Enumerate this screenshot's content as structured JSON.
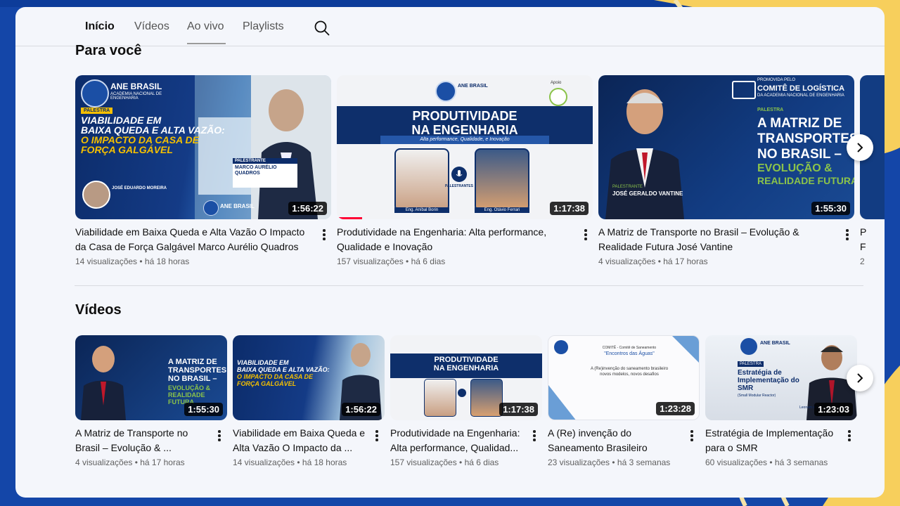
{
  "tabs": [
    {
      "label": "Início"
    },
    {
      "label": "Vídeos"
    },
    {
      "label": "Ao vivo"
    },
    {
      "label": "Playlists"
    }
  ],
  "sections": {
    "for_you": {
      "title": "Para você",
      "cards": [
        {
          "title_l1": "Viabilidade em Baixa Queda e Alta Vazão O Impacto",
          "title_l2": "da Casa de Força Galgável   Marco Aurélio Quadros",
          "meta": "14 visualizações • há 18 horas",
          "duration": "1:56:22",
          "thumb": {
            "brand": "ANE BRASIL",
            "brand_sub": "ACADEMIA NACIONAL DE ENGENHARIA",
            "tag": "PALESTRA",
            "headline1": "VIABILIDADE EM",
            "headline2": "BAIXA QUEDA E ALTA VAZÃO:",
            "headline3": "O IMPACTO DA CASA DE",
            "headline4": "FORÇA GALGÁVEL",
            "speaker_role": "PALESTRANTE",
            "speaker": "MARCO AURÉLIO QUADROS",
            "mod": "JOSÉ EDUARDO MOREIRA"
          }
        },
        {
          "title_l1": "Produtividade na Engenharia: Alta performance,",
          "title_l2": "Qualidade e Inovação",
          "meta": "157 visualizações • há 6 dias",
          "duration": "1:17:38",
          "thumb": {
            "headline1": "PRODUTIVIDADE",
            "headline2": "NA ENGENHARIA",
            "sub": "Alta performance, Qualidade, e Inovação",
            "left_name": "Eng. Aníbal Borin",
            "right_name": "Eng. Otávio Ferrari",
            "center": "PALESTRANTES",
            "apoio": "Apoio"
          }
        },
        {
          "title_l1": "A Matriz de Transporte no Brasil  – Evolução &",
          "title_l2": "Realidade Futura   José Vantine",
          "meta": "4 visualizações • há 17 horas",
          "duration": "1:55:30",
          "thumb": {
            "promo": "PROMOVIDA PELO",
            "committee": "COMITÊ DE LOGÍSTICA",
            "academy": "DA ACADEMIA NACIONAL DE ENGENHARIA",
            "tag": "PALESTRA",
            "headline1": "A MATRIZ DE",
            "headline2": "TRANSPORTES",
            "headline3": "NO BRASIL –",
            "headline4": "EVOLUÇÃO &",
            "headline5": "REALIDADE FUTURA",
            "speaker_role": "PALESTRANTE",
            "speaker": "JOSÉ GERALDO VANTINE"
          }
        },
        {
          "title_l1": "P",
          "title_l2": "F",
          "meta": "2"
        }
      ]
    },
    "videos": {
      "title": "Vídeos",
      "cards": [
        {
          "title_l1": "A Matriz de Transporte no",
          "title_l2": "Brasil  – Evolução & ...",
          "meta": "4 visualizações • há 17 horas",
          "duration": "1:55:30"
        },
        {
          "title_l1": "Viabilidade em Baixa Queda e",
          "title_l2": "Alta Vazão O Impacto da ...",
          "meta": "14 visualizações • há 18 horas",
          "duration": "1:56:22"
        },
        {
          "title_l1": "Produtividade na Engenharia:",
          "title_l2": "Alta performance, Qualidad...",
          "meta": "157 visualizações • há 6 dias",
          "duration": "1:17:38"
        },
        {
          "title_l1": "A (Re) invenção do",
          "title_l2": "Saneamento Brasileiro",
          "meta": "23 visualizações • há 3 semanas",
          "duration": "1:23:28",
          "thumb": {
            "line1": "COMITÊ - Comitê de Saneamento",
            "line2": "\"Encontros das Águas\"",
            "line3": "A (Re)invenção do saneamento brasileiro",
            "line4": "novos modelos, novos desafios"
          }
        },
        {
          "title_l1": "Estratégia de Implementação",
          "title_l2": "para o SMR",
          "meta": "60 visualizações • há 3 semanas",
          "duration": "1:23:03",
          "thumb": {
            "brand": "ANE BRASIL",
            "tag": "PALESTRA",
            "headline1": "Estratégia de",
            "headline2": "Implementação do",
            "headline3": "SMR",
            "sub": "(Small Modular Reactor)",
            "name": "Leonam dos"
          }
        }
      ]
    }
  },
  "icons": {
    "search": "search-icon",
    "next": "chevron-right-icon",
    "more": "more-vert-icon"
  },
  "colors": {
    "bg_blue": "#1446a8",
    "deco_yellow": "#f7cf5c",
    "thumb_navy": "#0e2f6b",
    "accent_yellow": "#f5c000",
    "accent_green": "#8bc34a",
    "progress_red": "#ff0033"
  }
}
